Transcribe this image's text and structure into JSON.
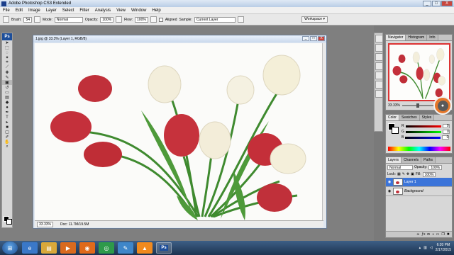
{
  "app": {
    "title": "Adobe Photoshop CS3 Extended",
    "logo": "Ps"
  },
  "window_controls": {
    "minimize": "_",
    "maximize": "□",
    "close": "X"
  },
  "menu": [
    "File",
    "Edit",
    "Image",
    "Layer",
    "Select",
    "Filter",
    "Analysis",
    "View",
    "Window",
    "Help"
  ],
  "options": {
    "brush_label": "Brush:",
    "brush_size": "54",
    "mode_label": "Mode:",
    "mode_value": "Normal",
    "opacity_label": "Opacity:",
    "opacity_value": "100%",
    "flow_label": "Flow:",
    "flow_value": "100%",
    "aligned_label": "Aligned",
    "sample_label": "Sample:",
    "sample_value": "Current Layer",
    "workspace_label": "Workspace ▾"
  },
  "document": {
    "title": "1.jpg @ 33.3% (Layer 1, RGB/8)",
    "zoom": "33.33%",
    "doc_info": "Doc: 11.7M/19.5M"
  },
  "navigator": {
    "tabs": [
      "Navigator",
      "Histogram",
      "Info"
    ],
    "zoom": "33.33%"
  },
  "color": {
    "tabs": [
      "Color",
      "Swatches",
      "Styles"
    ],
    "channels": [
      {
        "label": "R",
        "value": "0",
        "ramp": "#ff0000"
      },
      {
        "label": "G",
        "value": "0",
        "ramp": "#00ff00"
      },
      {
        "label": "B",
        "value": "0",
        "ramp": "#0000ff"
      }
    ]
  },
  "layers": {
    "tabs": [
      "Layers",
      "Channels",
      "Paths"
    ],
    "blend_mode": "Normal",
    "opacity_label": "Opacity:",
    "opacity_value": "100%",
    "lock_label": "Lock:",
    "fill_label": "Fill:",
    "fill_value": "100%",
    "items": [
      {
        "name": "Layer 1",
        "selected": true
      },
      {
        "name": "Background",
        "selected": false
      }
    ]
  },
  "taskbar": {
    "apps": [
      "ie-icon",
      "folder-icon",
      "media-player-icon",
      "firefox-icon",
      "chrome-icon",
      "paint-icon",
      "vlc-icon",
      "photoshop-icon"
    ],
    "active_app_label": "Ps",
    "time": "6:20 PM",
    "date": "2/17/2015"
  },
  "colors": {
    "accent": "#3b74d9",
    "tulip_red": "#c0303a",
    "tulip_white": "#f4efd8",
    "stem": "#3f8a2f"
  }
}
